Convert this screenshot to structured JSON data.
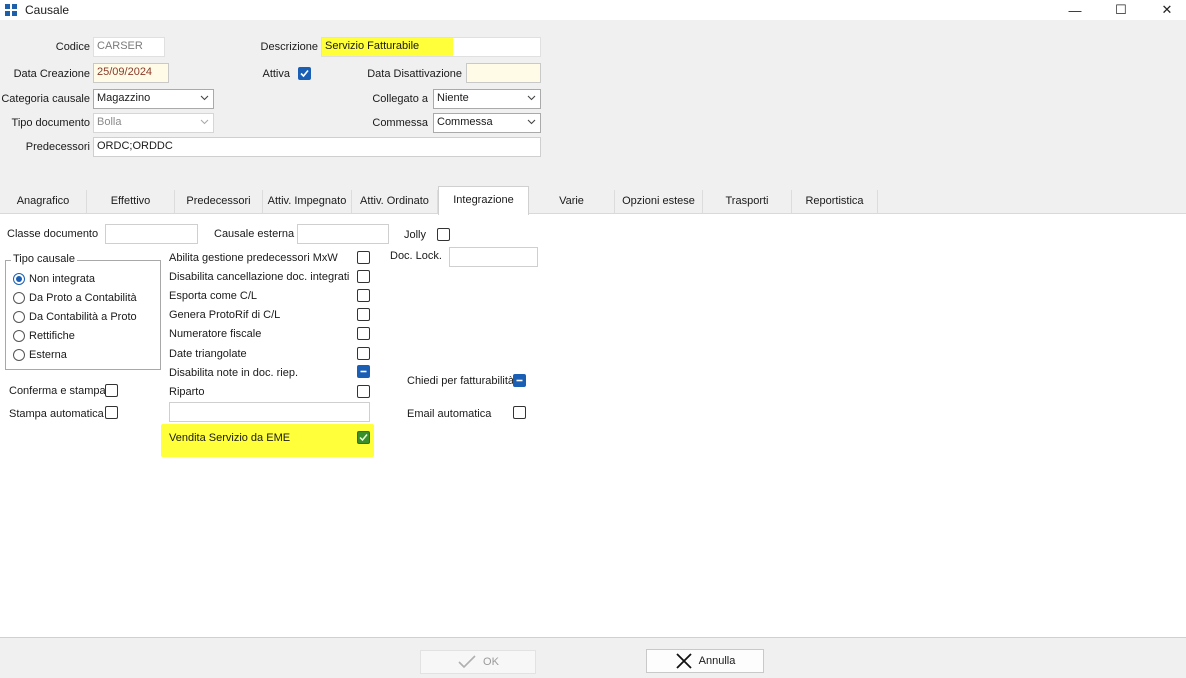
{
  "window": {
    "title": "Causale",
    "minimize": "—",
    "maximize": "☐",
    "close": "✕"
  },
  "header": {
    "codice_label": "Codice",
    "codice_value": "CARSER",
    "descrizione_label": "Descrizione",
    "descrizione_value": "Servizio Fatturabile",
    "data_creazione_label": "Data Creazione",
    "data_creazione_value": "25/09/2024",
    "attiva_label": "Attiva",
    "attiva_checked": true,
    "data_disattivazione_label": "Data Disattivazione",
    "data_disattivazione_value": "",
    "categoria_label": "Categoria causale",
    "categoria_value": "Magazzino",
    "collegato_label": "Collegato a",
    "collegato_value": "Niente",
    "tipo_documento_label": "Tipo documento",
    "tipo_documento_value": "Bolla",
    "commessa_label": "Commessa",
    "commessa_value": "Commessa",
    "predecessori_label": "Predecessori",
    "predecessori_value": "ORDC;ORDDC"
  },
  "tabs": [
    {
      "label": "Anagrafico"
    },
    {
      "label": "Effettivo"
    },
    {
      "label": "Predecessori"
    },
    {
      "label": "Attiv. Impegnato"
    },
    {
      "label": "Attiv. Ordinato"
    },
    {
      "label": "Integrazione",
      "active": true
    },
    {
      "label": "Varie"
    },
    {
      "label": "Opzioni estese"
    },
    {
      "label": "Trasporti"
    },
    {
      "label": "Reportistica"
    }
  ],
  "integrazione": {
    "classe_documento_label": "Classe documento",
    "classe_documento_value": "",
    "causale_esterna_label": "Causale esterna",
    "causale_esterna_value": "",
    "jolly_label": "Jolly",
    "doc_lock_label": "Doc. Lock.",
    "doc_lock_value": "",
    "tipo_causale_title": "Tipo causale",
    "tipo_causale_options": [
      {
        "label": "Non integrata",
        "selected": true
      },
      {
        "label": "Da Proto a Contabilità",
        "selected": false
      },
      {
        "label": "Da Contabilità a Proto",
        "selected": false
      },
      {
        "label": "Rettifiche",
        "selected": false
      },
      {
        "label": "Esterna",
        "selected": false
      }
    ],
    "options": [
      {
        "label": "Abilita gestione predecessori MxW",
        "state": "unchecked"
      },
      {
        "label": "Disabilita cancellazione doc. integrati",
        "state": "unchecked"
      },
      {
        "label": "Esporta come C/L",
        "state": "unchecked"
      },
      {
        "label": "Genera ProtoRif di C/L",
        "state": "unchecked"
      },
      {
        "label": "Numeratore fiscale",
        "state": "unchecked"
      },
      {
        "label": "Date triangolate",
        "state": "unchecked"
      },
      {
        "label": "Disabilita note in doc. riep.",
        "state": "indeterminate"
      },
      {
        "label": "Riparto",
        "state": "unchecked"
      }
    ],
    "riparto_value": "",
    "vendita_label": "Vendita Servizio da EME",
    "vendita_checked": true,
    "conferma_stampa_label": "Conferma e stampa",
    "stampa_automatica_label": "Stampa automatica",
    "chiedi_fatturabilita_label": "Chiedi per fatturabilità",
    "email_automatica_label": "Email automatica"
  },
  "footer": {
    "ok_label": "OK",
    "annulla_label": "Annulla"
  },
  "colors": {
    "highlight": "#ffff3a",
    "accent": "#1a5fb4",
    "checked_green": "#3a8f2a"
  }
}
